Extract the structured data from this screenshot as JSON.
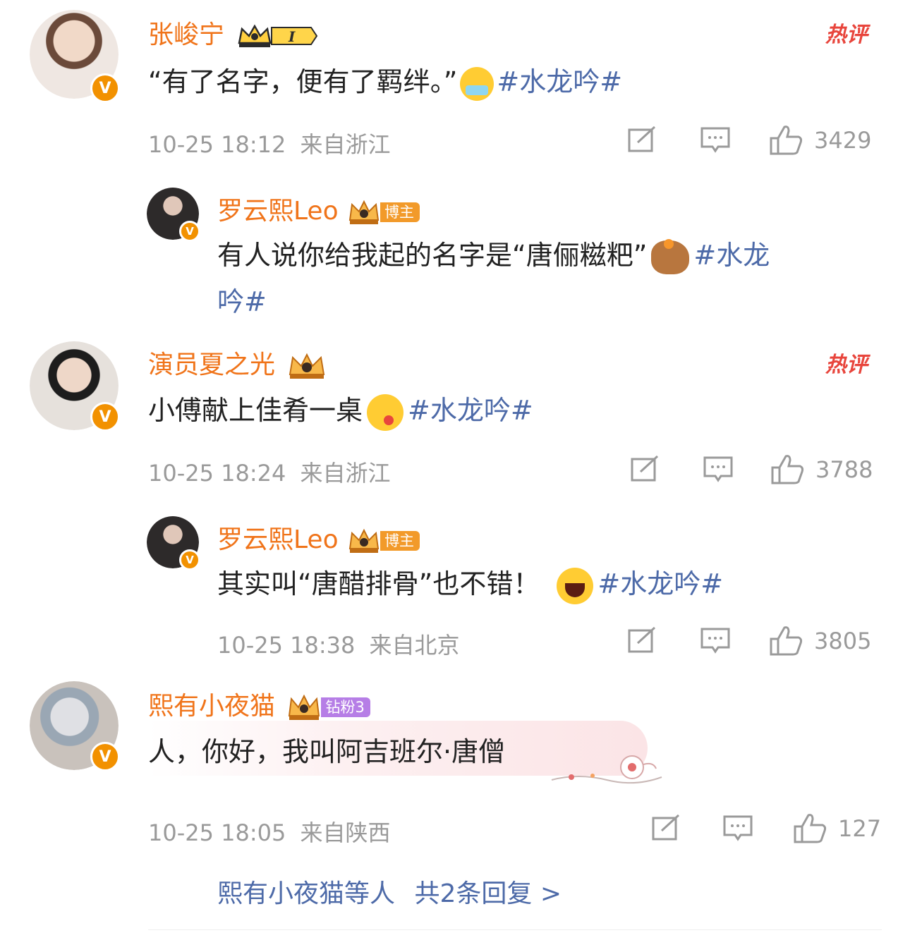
{
  "hot_label": "热评",
  "comments": [
    {
      "username": "张峻宁",
      "content": "“有了名字，便有了羁绊。”",
      "hashtag": "#水龙吟#",
      "time": "10-25 18:12",
      "location": "来自浙江",
      "likes": "3429",
      "level": "I"
    },
    {
      "username": "罗云熙Leo",
      "badge": "博主",
      "content_line1": "有人说你给我起的名字是“唐俪糍粑”",
      "hashtag_part1": "#水龙",
      "hashtag_part2": "吟#"
    },
    {
      "username": "演员夏之光",
      "content": "小傅献上佳肴一桌",
      "hashtag": "#水龙吟#",
      "time": "10-25 18:24",
      "location": "来自浙江",
      "likes": "3788"
    },
    {
      "username": "罗云熙Leo",
      "badge": "博主",
      "content": "其实叫“唐醋排骨”也不错！",
      "hashtag": "#水龙吟#",
      "time": "10-25 18:38",
      "location": "来自北京",
      "likes": "3805"
    },
    {
      "username": "熙有小夜猫",
      "badge": "钻粉3",
      "content": "人，你好，我叫阿吉班尔·唐僧",
      "time": "10-25 18:05",
      "location": "来自陕西",
      "likes": "127"
    }
  ],
  "more_replies": {
    "names": "熙有小夜猫等人",
    "count": "共2条回复 >"
  },
  "colors": {
    "username": "#f0741a",
    "hashtag": "#4d6aa8",
    "meta": "#9a9a9a",
    "hot": "#e8453c",
    "verified": "#f29100"
  }
}
